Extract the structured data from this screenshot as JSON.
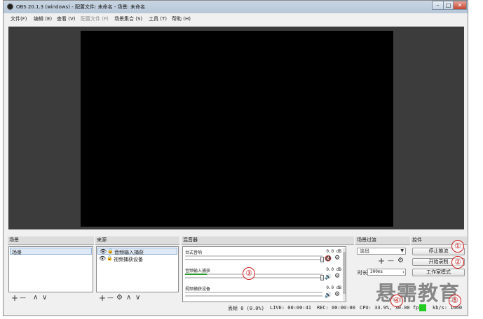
{
  "window": {
    "title": "OBS 20.1.3 (windows) - 配置文件: 未命名 - 场景: 未命名",
    "minimize": "–",
    "maximize": "□",
    "close": "✕"
  },
  "menu": [
    {
      "label": "文件(F)",
      "disabled": false
    },
    {
      "label": "编辑 (E)",
      "disabled": false
    },
    {
      "label": "查看 (V)",
      "disabled": false
    },
    {
      "label": "配置文件 (P)",
      "disabled": true
    },
    {
      "label": "场景集合 (S)",
      "disabled": false
    },
    {
      "label": "工具 (T)",
      "disabled": false
    },
    {
      "label": "帮助 (H)",
      "disabled": false
    }
  ],
  "docks": {
    "scenes": {
      "title": "场景",
      "items": [
        "场景"
      ],
      "add": "+",
      "remove": "—",
      "up": "∧",
      "down": "∨"
    },
    "sources": {
      "title": "来源",
      "items": [
        "音频输入捕获",
        "视频捕获设备"
      ],
      "add": "+",
      "remove": "—",
      "up": "∧",
      "down": "∨"
    },
    "mixer": {
      "title": "混音器",
      "channels": [
        {
          "name": "台式音响",
          "db": "0.0 dB",
          "muted": true,
          "level": 0.0
        },
        {
          "name": "音频输入捕获",
          "db": "0.0 dB",
          "muted": false,
          "level": 0.16
        },
        {
          "name": "视频捕获设备",
          "db": "0.0 dB",
          "muted": false,
          "level": 0.0
        }
      ]
    },
    "transitions": {
      "title": "场景过渡",
      "selected": "淡出",
      "add": "+",
      "remove": "—",
      "duration_label": "时长",
      "duration_value": "300ms"
    },
    "controls": {
      "title": "控件",
      "buttons": [
        "停止推流",
        "开始录制",
        "工作室模式"
      ]
    }
  },
  "status": {
    "dropped": "丢帧 0 (0.0%)",
    "live": "LIVE: 00:00:41",
    "rec": "REC: 00:00:00",
    "cpu": "CPU: 33.9%, 30.00 fps",
    "kbps": "kb/s: 1660",
    "indicator_color": "#22cc22"
  },
  "annotations": [
    "①",
    "②",
    "③",
    "④",
    "⑤"
  ],
  "watermark": "悬需教育"
}
